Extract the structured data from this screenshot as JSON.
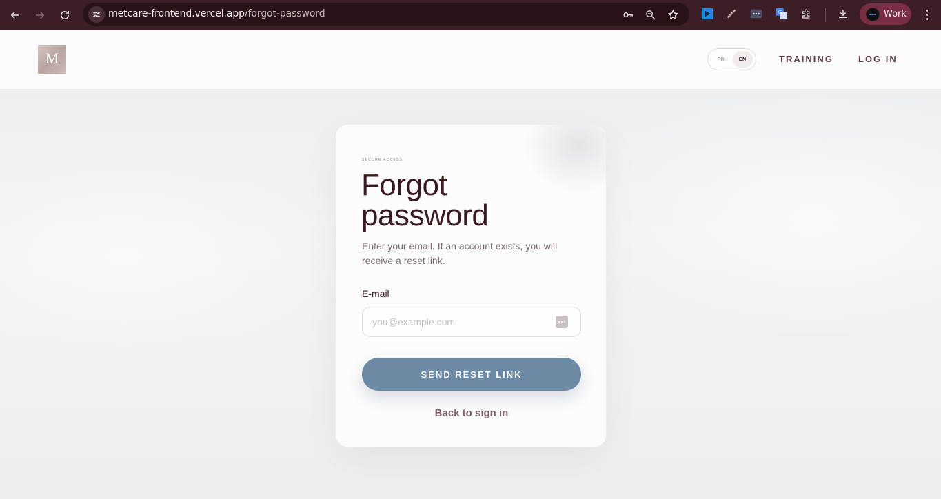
{
  "browser": {
    "url_host": "metcare-frontend.vercel.app",
    "url_path": "/forgot-password",
    "profile_label": "Work",
    "icons": {
      "back": "back-arrow-icon",
      "forward": "forward-arrow-icon",
      "reload": "reload-icon",
      "site_settings": "tune-icon",
      "password": "key-icon",
      "zoom": "zoom-icon",
      "bookmark": "star-icon",
      "extensions": "puzzle-icon",
      "downloads": "download-icon",
      "menu": "kebab-menu-icon"
    }
  },
  "header": {
    "logo_letter": "M",
    "lang": {
      "fr": "FR",
      "en": "EN",
      "active": "EN"
    },
    "nav": {
      "training": "TRAINING",
      "login": "LOG IN"
    }
  },
  "card": {
    "eyebrow": "SECURE ACCESS",
    "title": "Forgot password",
    "description": "Enter your email. If an account exists, you will receive a reset link.",
    "email_label": "E-mail",
    "email_placeholder": "you@example.com",
    "email_value": "",
    "submit_label": "SEND RESET LINK",
    "back_link": "Back to sign in"
  },
  "colors": {
    "chrome_bg": "#3c1f26",
    "brand_dark": "#3a1a20",
    "button": "#6d8aa5",
    "link": "#7d6469"
  }
}
